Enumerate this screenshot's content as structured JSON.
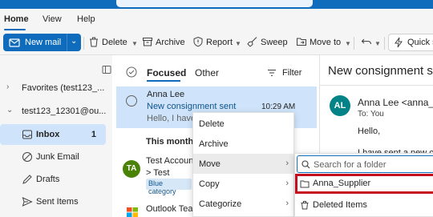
{
  "menu_tabs": [
    {
      "label": "Home"
    },
    {
      "label": "View"
    },
    {
      "label": "Help"
    }
  ],
  "ribbon": {
    "new_mail": "New mail",
    "delete": "Delete",
    "archive": "Archive",
    "report": "Report",
    "sweep": "Sweep",
    "move_to": "Move to",
    "quick_steps": "Quick s"
  },
  "folders": {
    "favorites": "Favorites (test123_...",
    "account": "test123_12301@ou...",
    "items": [
      {
        "label": "Inbox",
        "count": "1"
      },
      {
        "label": "Junk Email"
      },
      {
        "label": "Drafts"
      },
      {
        "label": "Sent Items"
      }
    ]
  },
  "message_list": {
    "tab_focused": "Focused",
    "tab_other": "Other",
    "filter": "Filter",
    "section_this_month": "This month",
    "messages": [
      {
        "sender": "Anna Lee",
        "subject": "New consignment sent",
        "time": "10:29 AM",
        "preview": "Hello, I have s"
      },
      {
        "avatar": "TA",
        "sender": "Test Account",
        "subject": "> Test",
        "category": "Blue category"
      },
      {
        "sender": "Outlook Team"
      }
    ]
  },
  "reading": {
    "title": "New consignment se",
    "avatar": "AL",
    "from": "Anna Lee <anna_su",
    "to": "To:  You",
    "greeting": "Hello,",
    "body": "I have sent a new co"
  },
  "context_menu": {
    "items": [
      {
        "label": "Delete"
      },
      {
        "label": "Archive"
      },
      {
        "label": "Move",
        "arrow": "›"
      },
      {
        "label": "Copy",
        "arrow": "›"
      },
      {
        "label": "Categorize",
        "arrow": "›"
      }
    ]
  },
  "move_submenu": {
    "search_placeholder": "Search for a folder",
    "folders": [
      {
        "label": "Anna_Supplier"
      },
      {
        "label": "Deleted Items"
      }
    ]
  },
  "colors": {
    "brand": "#0f6cbd",
    "selection": "#cfe4fa",
    "highlight_border": "#c50f1f"
  }
}
